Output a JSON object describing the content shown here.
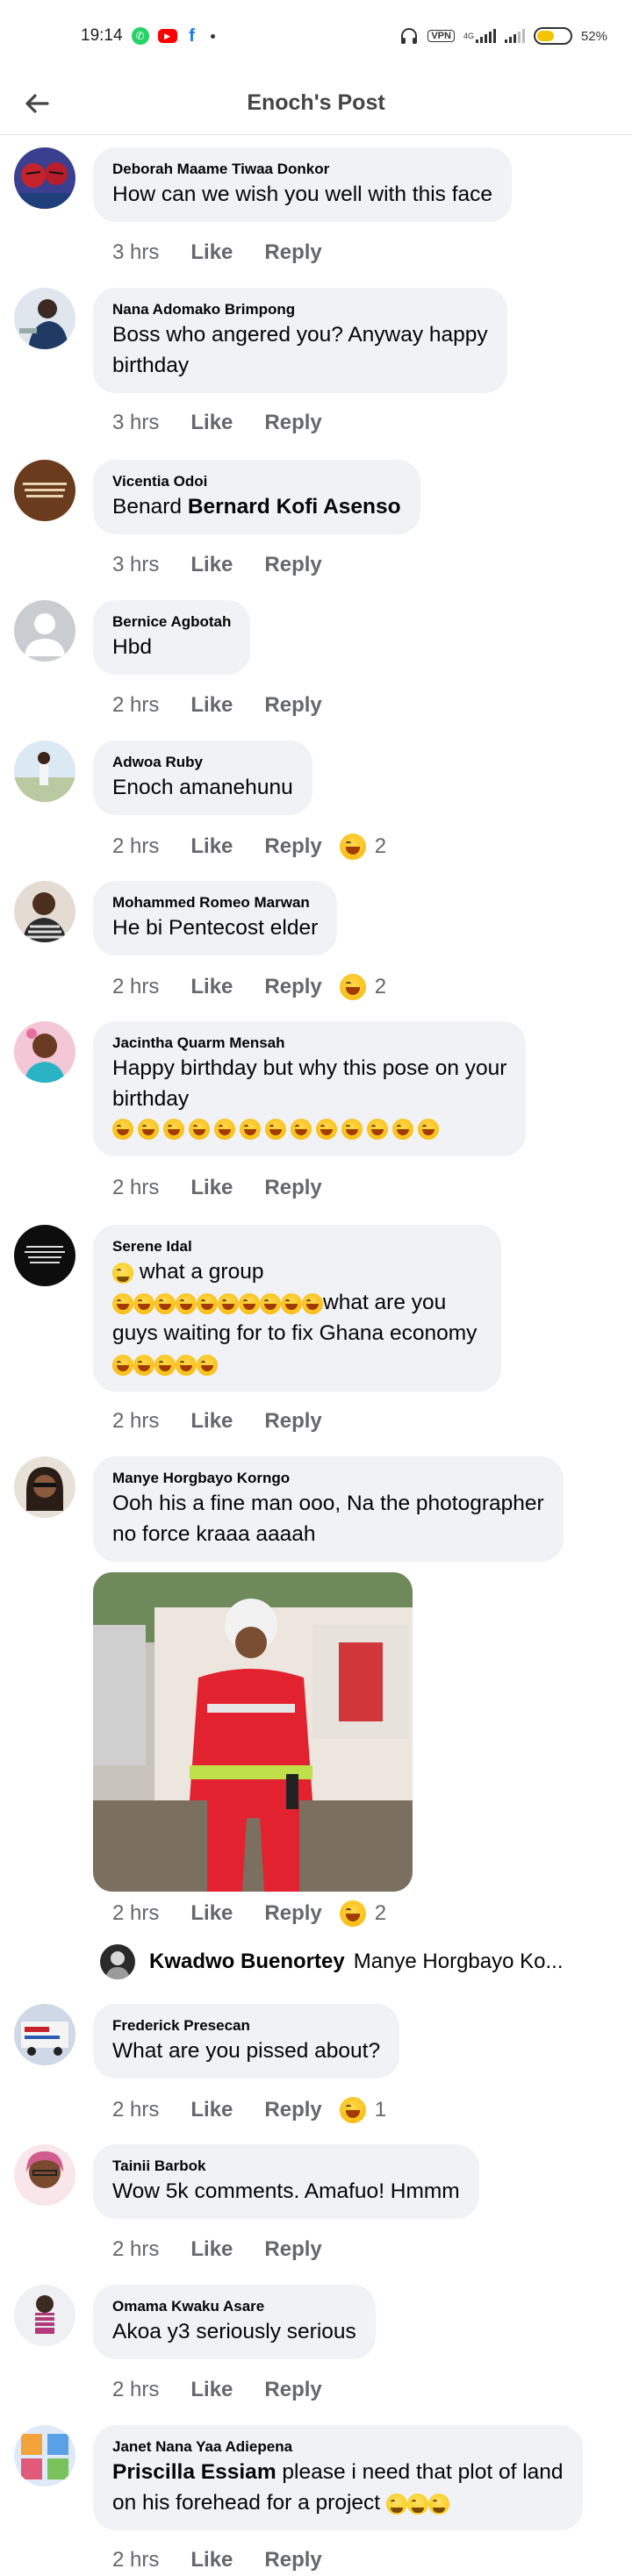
{
  "status_bar": {
    "time": "19:14",
    "vpn": "VPN",
    "network": "4G",
    "battery": "52%",
    "battery_level": 0.52
  },
  "header": {
    "title": "Enoch's Post"
  },
  "comments": [
    {
      "name": "Deborah Maame Tiwaa Donkor",
      "text": "How can we wish you well with this face",
      "time": "3 hrs",
      "like": "Like",
      "reply": "Reply"
    },
    {
      "name": "Nana Adomako Brimpong",
      "text_line1": "Boss who angered you? Anyway happy",
      "text_line2": "birthday",
      "time": "3 hrs",
      "like": "Like",
      "reply": "Reply"
    },
    {
      "name": "Vicentia Odoi",
      "text_prefix": "Benard ",
      "mention": "Bernard Kofi Asenso",
      "time": "3 hrs",
      "like": "Like",
      "reply": "Reply"
    },
    {
      "name": "Bernice Agbotah",
      "text": "Hbd",
      "time": "2 hrs",
      "like": "Like",
      "reply": "Reply"
    },
    {
      "name": "Adwoa Ruby",
      "text": "Enoch amanehunu",
      "time": "2 hrs",
      "like": "Like",
      "reply": "Reply",
      "reactions": "2"
    },
    {
      "name": "Mohammed Romeo Marwan",
      "text": "He bi Pentecost elder",
      "time": "2 hrs",
      "like": "Like",
      "reply": "Reply",
      "reactions": "2"
    },
    {
      "name": "Jacintha Quarm Mensah",
      "text_line1": "Happy birthday but why this pose on your",
      "text_line2": "birthday",
      "emoji_count": 13,
      "time": "2 hrs",
      "like": "Like",
      "reply": "Reply"
    },
    {
      "name": "Serene Idal",
      "text_line1": "what a group",
      "text_line2": "what are you",
      "text_line3": "guys waiting for to fix Ghana economy",
      "time": "2 hrs",
      "like": "Like",
      "reply": "Reply"
    },
    {
      "name": "Manye Horgbayo Korngo",
      "text_line1": "Ooh his a fine man ooo, Na the photographer",
      "text_line2": "no force kraaa aaaah",
      "time": "2 hrs",
      "like": "Like",
      "reply": "Reply",
      "reactions": "2",
      "reply_preview": {
        "name": "Kwadwo Buenortey",
        "text": "Manye Horgbayo Ko..."
      }
    },
    {
      "name": "Frederick Presecan",
      "text": "What are you pissed about?",
      "time": "2 hrs",
      "like": "Like",
      "reply": "Reply",
      "reactions": "1"
    },
    {
      "name": "Tainii Barbok",
      "text": "Wow 5k comments. Amafuo! Hmmm",
      "time": "2 hrs",
      "like": "Like",
      "reply": "Reply"
    },
    {
      "name": "Omama Kwaku Asare",
      "text": "Akoa y3 seriously serious",
      "time": "2 hrs",
      "like": "Like",
      "reply": "Reply"
    },
    {
      "name": "Janet Nana Yaa Adiepena",
      "mention": "Priscilla Essiam",
      "text_line1": " please i need that plot of land",
      "text_line2": "on his forehead for a project",
      "time": "2 hrs",
      "like": "Like",
      "reply": "Reply"
    }
  ],
  "icons": {
    "back": "arrow-left-icon",
    "reaction": "laughing-emoji-icon"
  }
}
